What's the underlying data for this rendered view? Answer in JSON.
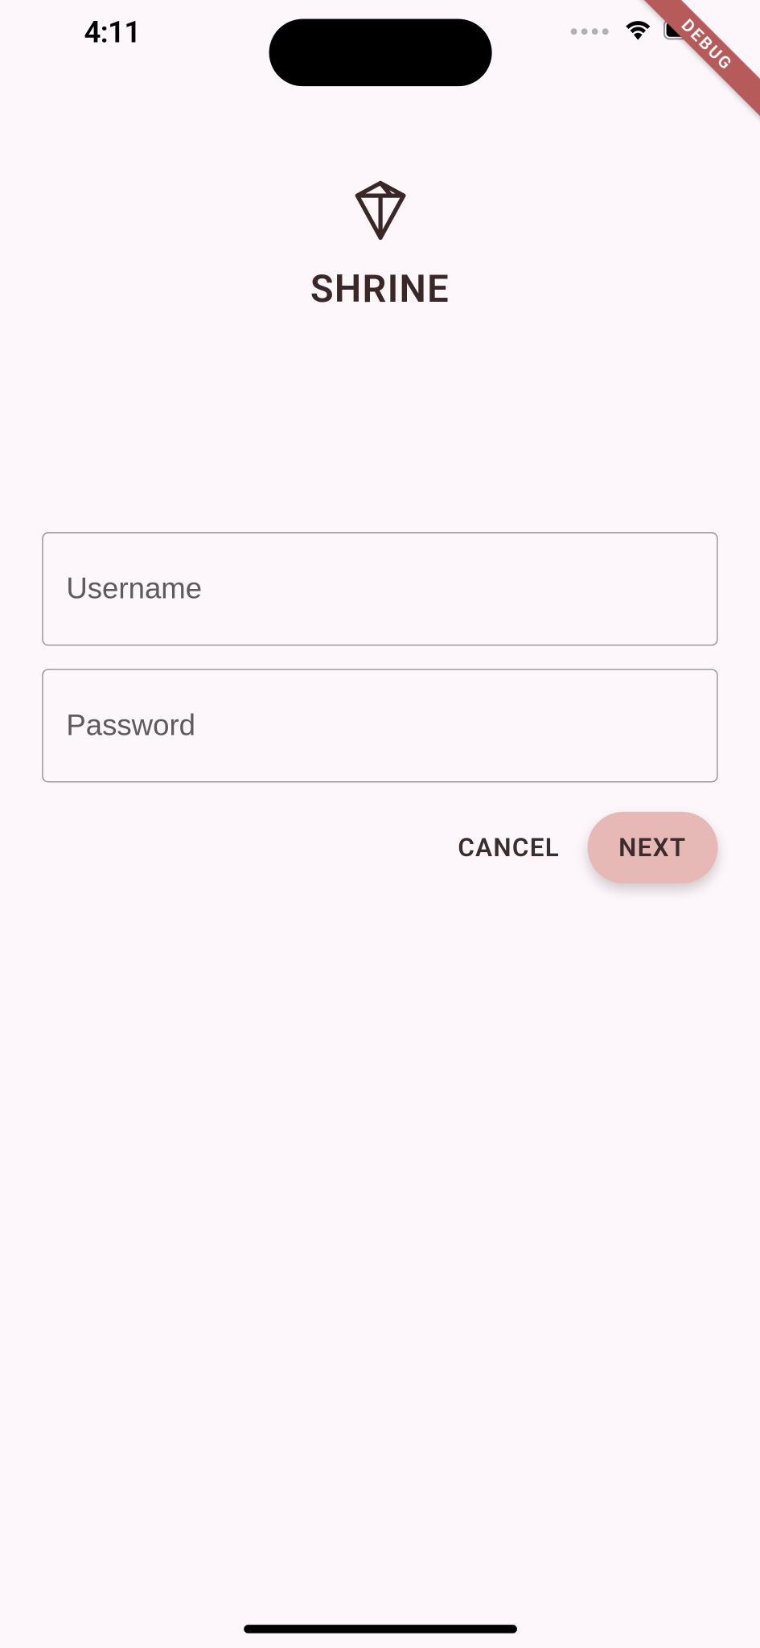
{
  "status_bar": {
    "time": "4:11"
  },
  "debug_banner": "DEBUG",
  "logo": {
    "title": "SHRINE"
  },
  "form": {
    "username": {
      "placeholder": "Username",
      "value": ""
    },
    "password": {
      "placeholder": "Password",
      "value": ""
    }
  },
  "buttons": {
    "cancel": "CANCEL",
    "next": "NEXT"
  }
}
